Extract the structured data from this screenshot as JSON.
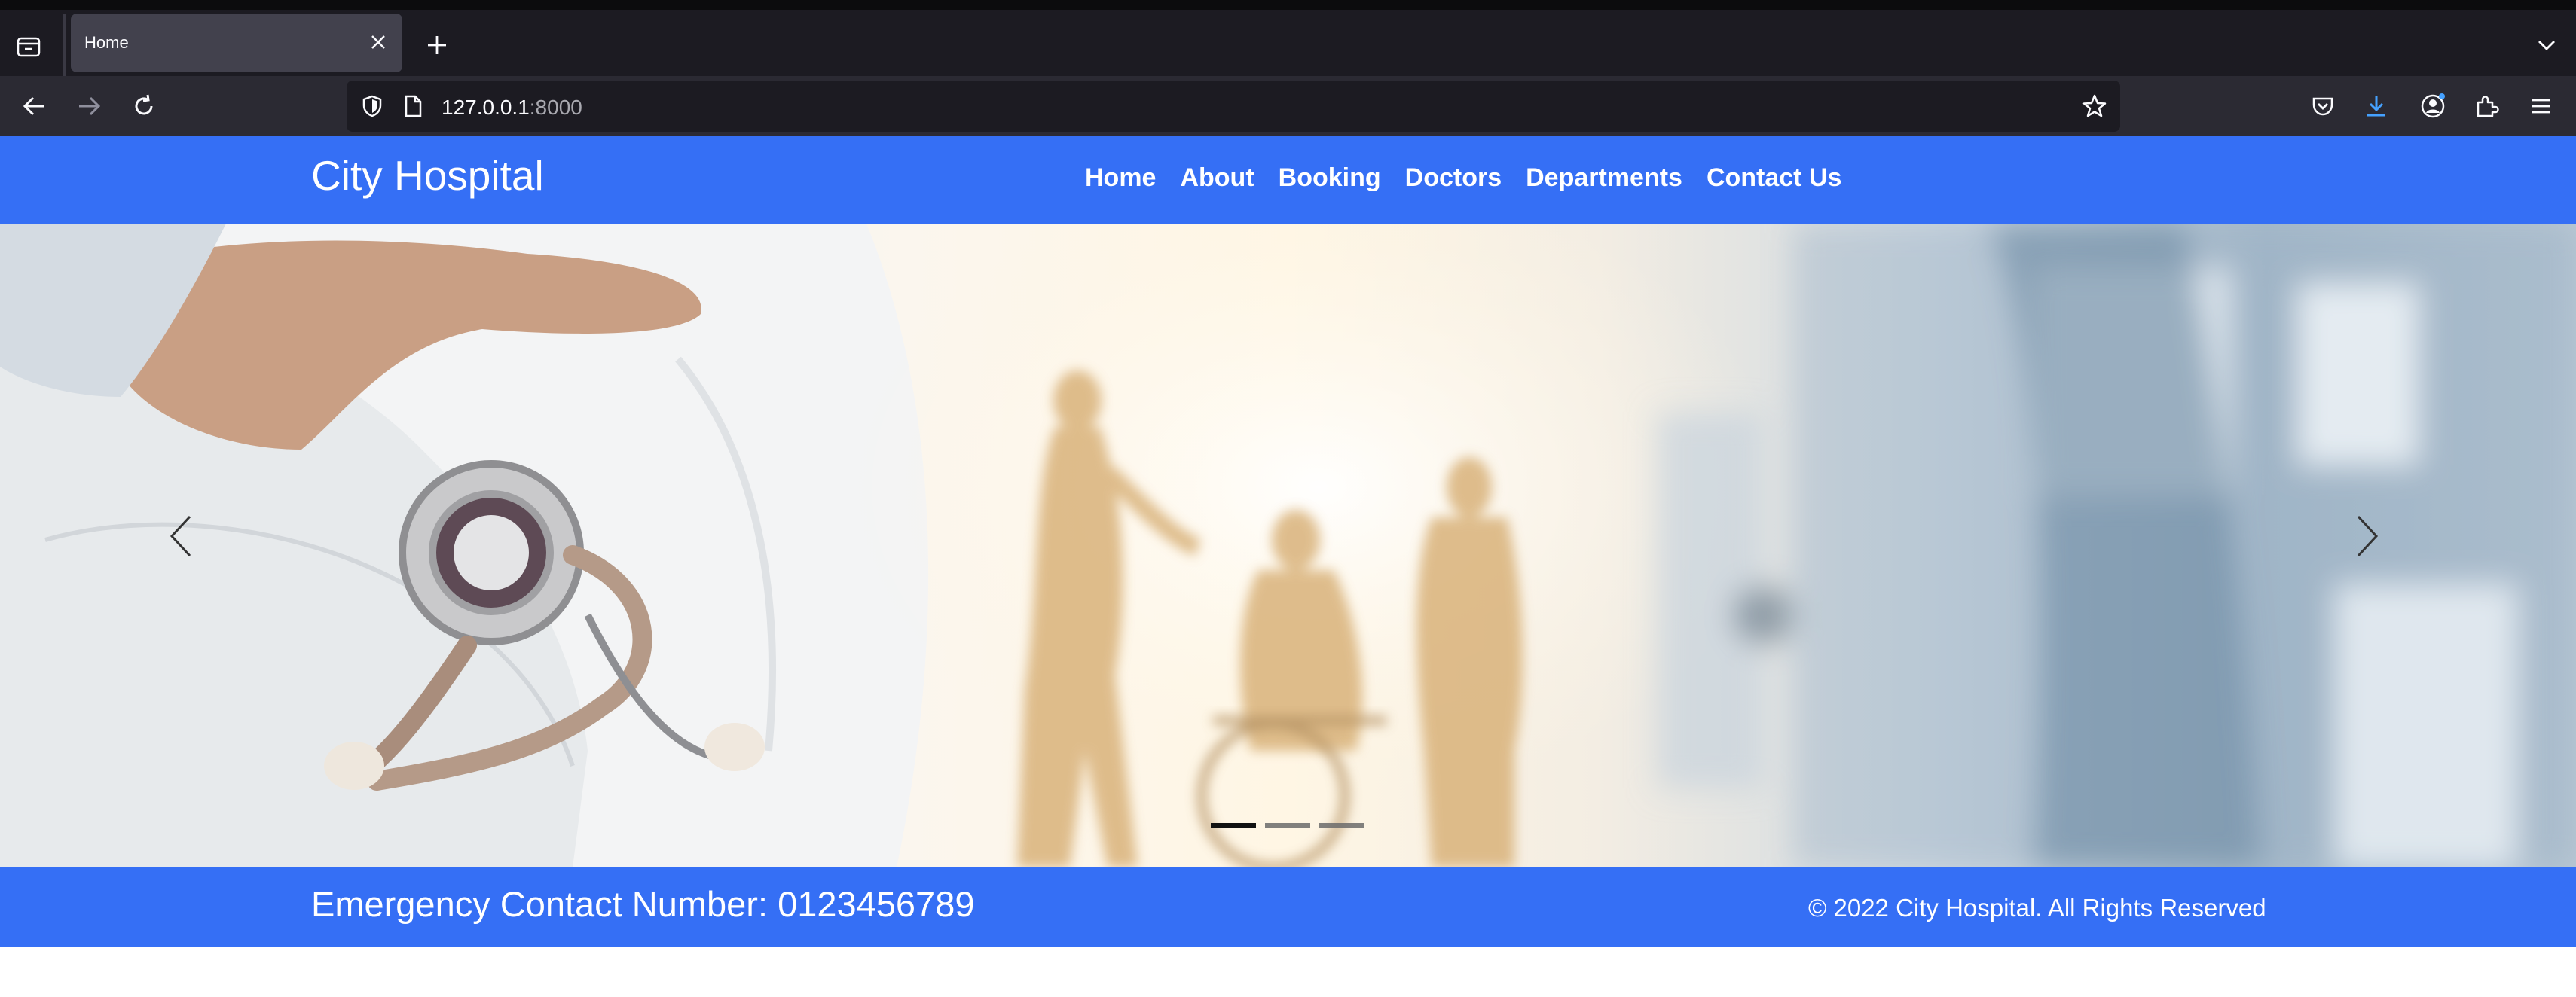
{
  "browser": {
    "tab": {
      "title": "Home"
    },
    "url": {
      "host": "127.0.0.1",
      "port": ":8000"
    }
  },
  "site": {
    "brand": "City Hospital",
    "nav": [
      "Home",
      "About",
      "Booking",
      "Doctors",
      "Departments",
      "Contact Us"
    ],
    "hero": {
      "slide_count": 3,
      "active_slide": 1
    },
    "footer": {
      "emergency": "Emergency Contact Number: 0123456789",
      "copyright": "© 2022 City Hospital. All Rights Reserved"
    }
  },
  "colors": {
    "brand_blue": "#356ff5",
    "chrome_dark": "#1c1b22",
    "toolbar": "#2b2a33"
  },
  "icons": [
    "tab-list-icon",
    "close-icon",
    "plus-icon",
    "back-arrow-icon",
    "forward-arrow-icon",
    "reload-icon",
    "shield-icon",
    "page-icon",
    "star-icon",
    "pocket-icon",
    "download-icon",
    "account-icon",
    "extensions-icon",
    "menu-icon",
    "chevron-down-icon",
    "chevron-left-icon",
    "chevron-right-icon"
  ]
}
